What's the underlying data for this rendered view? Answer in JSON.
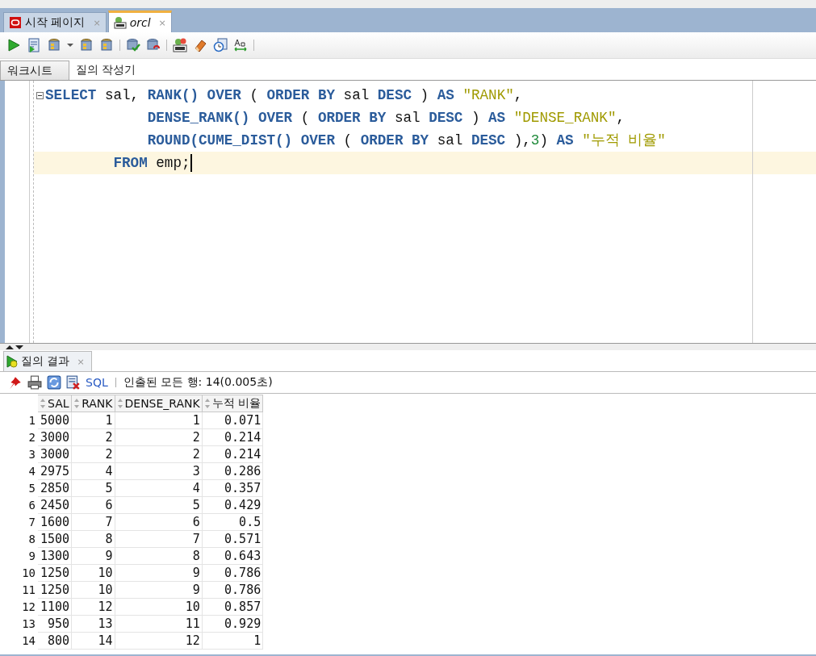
{
  "editor_tabs": [
    {
      "label": "시작 페이지",
      "close": "×",
      "selected": false,
      "kind": "start"
    },
    {
      "label": "orcl",
      "close": "×",
      "selected": true,
      "kind": "sql"
    }
  ],
  "subtabs": [
    {
      "label": "워크시트",
      "selected": true
    },
    {
      "label": "질의 작성기",
      "selected": false
    }
  ],
  "editor": {
    "lines": [
      {
        "current": false,
        "foldable": true,
        "tokens": [
          {
            "kind": "kw",
            "text": "SELECT"
          },
          {
            "kind": "plain",
            "text": " sal, "
          },
          {
            "kind": "kw",
            "text": "RANK() OVER"
          },
          {
            "kind": "plain",
            "text": " ( "
          },
          {
            "kind": "kw",
            "text": "ORDER BY"
          },
          {
            "kind": "plain",
            "text": " sal "
          },
          {
            "kind": "kw",
            "text": "DESC"
          },
          {
            "kind": "plain",
            "text": " ) "
          },
          {
            "kind": "kw",
            "text": "AS "
          },
          {
            "kind": "str",
            "text": "\"RANK\""
          },
          {
            "kind": "plain",
            "text": ","
          }
        ]
      },
      {
        "current": false,
        "foldable": false,
        "tokens": [
          {
            "kind": "kw",
            "text": "            DENSE_RANK() OVER"
          },
          {
            "kind": "plain",
            "text": " ( "
          },
          {
            "kind": "kw",
            "text": "ORDER BY"
          },
          {
            "kind": "plain",
            "text": " sal "
          },
          {
            "kind": "kw",
            "text": "DESC"
          },
          {
            "kind": "plain",
            "text": " ) "
          },
          {
            "kind": "kw",
            "text": "AS "
          },
          {
            "kind": "str",
            "text": "\"DENSE_RANK\""
          },
          {
            "kind": "plain",
            "text": ","
          }
        ]
      },
      {
        "current": false,
        "foldable": false,
        "tokens": [
          {
            "kind": "kw",
            "text": "            ROUND(CUME_DIST() OVER"
          },
          {
            "kind": "plain",
            "text": " ( "
          },
          {
            "kind": "kw",
            "text": "ORDER BY"
          },
          {
            "kind": "plain",
            "text": " sal "
          },
          {
            "kind": "kw",
            "text": "DESC"
          },
          {
            "kind": "plain",
            "text": " ),"
          },
          {
            "kind": "num",
            "text": "3"
          },
          {
            "kind": "plain",
            "text": ") "
          },
          {
            "kind": "kw",
            "text": "AS "
          },
          {
            "kind": "str",
            "text": "\"누적 비율\""
          }
        ]
      },
      {
        "current": true,
        "foldable": false,
        "tokens": [
          {
            "kind": "kw",
            "text": "        FROM"
          },
          {
            "kind": "plain",
            "text": " emp;"
          }
        ]
      }
    ]
  },
  "results": {
    "tab": {
      "label": "질의 결과",
      "close": "×"
    },
    "sql_link": "SQL",
    "status": "인출된 모든 행: 14(0.005초)",
    "columns": [
      "SAL",
      "RANK",
      "DENSE_RANK",
      "누적 비율"
    ],
    "rows": [
      {
        "num": "1",
        "cells": [
          "5000",
          "1",
          "1",
          "0.071"
        ]
      },
      {
        "num": "2",
        "cells": [
          "3000",
          "2",
          "2",
          "0.214"
        ]
      },
      {
        "num": "3",
        "cells": [
          "3000",
          "2",
          "2",
          "0.214"
        ]
      },
      {
        "num": "4",
        "cells": [
          "2975",
          "4",
          "3",
          "0.286"
        ]
      },
      {
        "num": "5",
        "cells": [
          "2850",
          "5",
          "4",
          "0.357"
        ]
      },
      {
        "num": "6",
        "cells": [
          "2450",
          "6",
          "5",
          "0.429"
        ]
      },
      {
        "num": "7",
        "cells": [
          "1600",
          "7",
          "6",
          "0.5"
        ]
      },
      {
        "num": "8",
        "cells": [
          "1500",
          "8",
          "7",
          "0.571"
        ]
      },
      {
        "num": "9",
        "cells": [
          "1300",
          "9",
          "8",
          "0.643"
        ]
      },
      {
        "num": "10",
        "cells": [
          "1250",
          "10",
          "9",
          "0.786"
        ]
      },
      {
        "num": "11",
        "cells": [
          "1250",
          "10",
          "9",
          "0.786"
        ]
      },
      {
        "num": "12",
        "cells": [
          "1100",
          "12",
          "10",
          "0.857"
        ]
      },
      {
        "num": "13",
        "cells": [
          "950",
          "13",
          "11",
          "0.929"
        ]
      },
      {
        "num": "14",
        "cells": [
          "800",
          "14",
          "12",
          "1"
        ]
      }
    ]
  }
}
